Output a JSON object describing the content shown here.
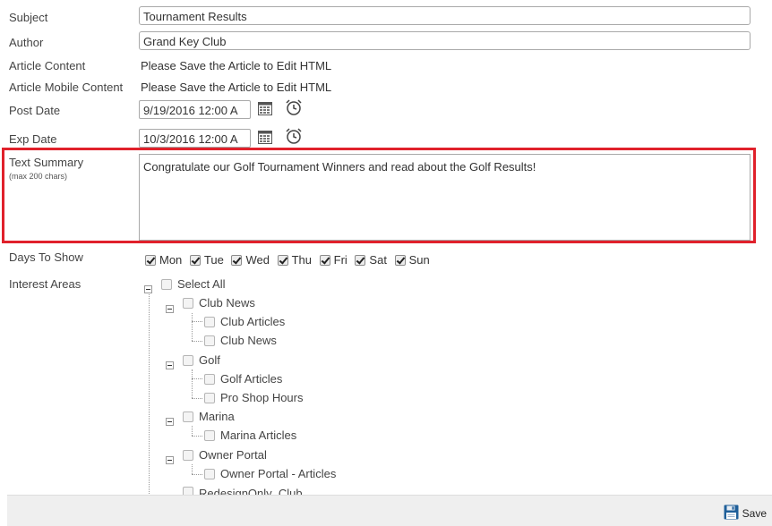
{
  "form": {
    "subject_label": "Subject",
    "subject_value": "Tournament Results",
    "author_label": "Author",
    "author_value": "Grand Key Club",
    "article_content_label": "Article Content",
    "article_content_value": "Please Save the Article to Edit HTML",
    "article_mobile_label": "Article Mobile Content",
    "article_mobile_value": "Please Save the Article to Edit HTML",
    "post_date_label": "Post Date",
    "post_date_value": "9/19/2016 12:00 A",
    "exp_date_label": "Exp Date",
    "exp_date_value": "10/3/2016 12:00 A",
    "text_summary_label": "Text Summary",
    "text_summary_hint": "(max 200 chars)",
    "text_summary_value": "Congratulate our Golf Tournament Winners and read about the Golf Results!",
    "days_label": "Days To Show",
    "interest_label": "Interest Areas"
  },
  "days": [
    {
      "label": "Mon",
      "checked": true
    },
    {
      "label": "Tue",
      "checked": true
    },
    {
      "label": "Wed",
      "checked": true
    },
    {
      "label": "Thu",
      "checked": true
    },
    {
      "label": "Fri",
      "checked": true
    },
    {
      "label": "Sat",
      "checked": true
    },
    {
      "label": "Sun",
      "checked": true
    }
  ],
  "interest_tree": {
    "select_all": "Select All",
    "club_news": "Club News",
    "club_articles": "Club Articles",
    "club_news_child": "Club News",
    "golf": "Golf",
    "golf_articles": "Golf Articles",
    "pro_shop_hours": "Pro Shop Hours",
    "marina": "Marina",
    "marina_articles": "Marina Articles",
    "owner_portal": "Owner Portal",
    "owner_portal_articles": "Owner Portal - Articles",
    "redesign_only": "RedesignOnly_Club"
  },
  "toolbar": {
    "save_label": "Save"
  },
  "colors": {
    "highlight": "#e0212b",
    "save_icon": "#1f5f99"
  }
}
